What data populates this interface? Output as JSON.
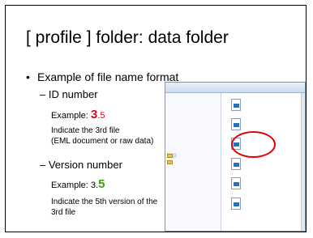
{
  "slide": {
    "title": "[ profile ] folder: data folder",
    "bullet": "Example of file name format",
    "id_section": {
      "heading": "– ID number",
      "example_prefix": "Example: ",
      "example_highlight": "3",
      "example_suffix": ".5",
      "note_line1": "Indicate the 3rd file",
      "note_line2": "(EML document or raw data)"
    },
    "version_section": {
      "heading": "– Version number",
      "example_prefix": "Example: 3.",
      "example_highlight": "5",
      "note_line1": "Indicate the 5th version of the",
      "note_line2": "3rd file"
    },
    "colors": {
      "id_highlight": "#e4001b",
      "version_highlight": "#3aa10a",
      "circle": "#e00000"
    }
  }
}
